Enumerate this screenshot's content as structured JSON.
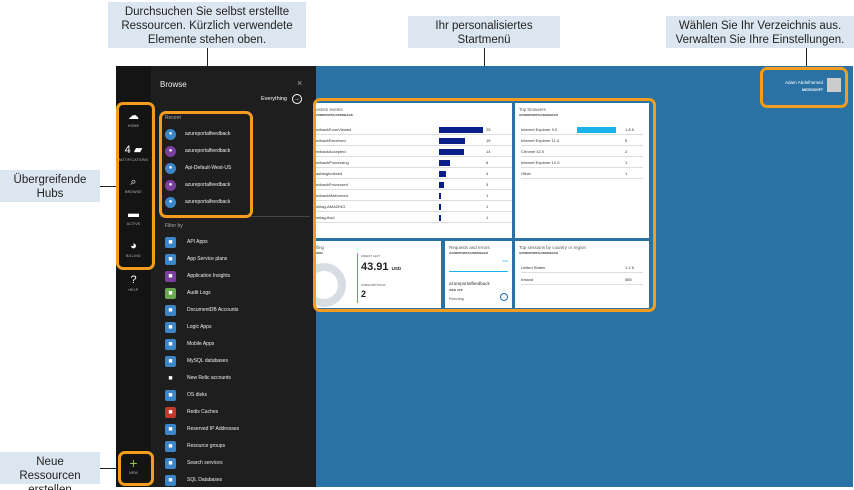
{
  "callouts": {
    "browse_resources": "Durchsuchen Sie selbst erstellte Ressourcen. Kürzlich verwendete Elemente stehen oben.",
    "personal_startboard": "Ihr personalisiertes Startmenü",
    "directory": "Wählen Sie Ihr Verzeichnis aus. Verwalten Sie Ihre Einstellungen.",
    "global_hubs": "Übergreifende Hubs",
    "new_resources": "Neue Ressourcen erstellen"
  },
  "hubs": [
    {
      "label": "HOME",
      "icon": "cloud-icon"
    },
    {
      "label": "NOTIFICATIONS",
      "count": "4",
      "icon": "notification-icon"
    },
    {
      "label": "BROWSE",
      "icon": "browse-icon"
    },
    {
      "label": "ACTIVE",
      "icon": "active-icon"
    },
    {
      "label": "BILLING",
      "icon": "billing-icon"
    },
    {
      "label": "HELP",
      "icon": "help-icon"
    },
    {
      "label": "NEW",
      "icon": "plus-icon"
    }
  ],
  "browse": {
    "title": "Browse",
    "close": "×",
    "everything": "Everything",
    "recent_label": "Recent",
    "recent": [
      {
        "label": "azureportalfeedback",
        "icon": "website-icon",
        "color": "#3a86c8"
      },
      {
        "label": "azureportalfeedback",
        "icon": "insights-icon",
        "color": "#7b3fa0"
      },
      {
        "label": "Api-Default-West-US",
        "icon": "resource-group-icon",
        "color": "#3a86c8"
      },
      {
        "label": "azureportalfeedback",
        "icon": "insights-icon",
        "color": "#7b3fa0"
      },
      {
        "label": "azureportalfeedback",
        "icon": "website-icon",
        "color": "#3a86c8"
      }
    ],
    "filter_label": "Filter by",
    "filter_items": [
      {
        "label": "API Apps",
        "icon": "api-apps-icon",
        "color": "#3a86c8"
      },
      {
        "label": "App Service plans",
        "icon": "app-service-plan-icon",
        "color": "#3a86c8"
      },
      {
        "label": "Application Insights",
        "icon": "insights-icon",
        "color": "#7b3fa0"
      },
      {
        "label": "Audit Logs",
        "icon": "audit-logs-icon",
        "color": "#6aa84f"
      },
      {
        "label": "DocumentDB Accounts",
        "icon": "documentdb-icon",
        "color": "#3a86c8"
      },
      {
        "label": "Logic Apps",
        "icon": "logic-apps-icon",
        "color": "#3a86c8"
      },
      {
        "label": "Mobile Apps",
        "icon": "mobile-apps-icon",
        "color": "#3a86c8"
      },
      {
        "label": "MySQL databases",
        "icon": "mysql-icon",
        "color": "#3a86c8"
      },
      {
        "label": "New Relic accounts",
        "icon": "new-relic-icon",
        "color": "#1e1e1e"
      },
      {
        "label": "OS disks",
        "icon": "disk-icon",
        "color": "#3a86c8"
      },
      {
        "label": "Redis Caches",
        "icon": "redis-icon",
        "color": "#c0392b"
      },
      {
        "label": "Reserved IP Addresses",
        "icon": "ip-address-icon",
        "color": "#3a86c8"
      },
      {
        "label": "Resource groups",
        "icon": "resource-group-icon",
        "color": "#3a86c8"
      },
      {
        "label": "Search services",
        "icon": "search-service-icon",
        "color": "#3a86c8"
      },
      {
        "label": "SQL Databases",
        "icon": "sql-database-icon",
        "color": "#3a86c8"
      }
    ]
  },
  "user": {
    "name": "Adam Abdelhamed",
    "directory": "MICROSOFT"
  },
  "tiles": {
    "custom_events": {
      "title": "ustom events",
      "subtitle": "ZUREPORTALFEEDBACK",
      "rows": [
        {
          "name": "edbackFormViewed",
          "value": 25
        },
        {
          "name": "edbackReceived",
          "value": 15
        },
        {
          "name": "edbackAccepted",
          "value": 14
        },
        {
          "name": "edbackProcessing",
          "value": 6
        },
        {
          "name": "ashtagIndexed",
          "value": 4
        },
        {
          "name": "edbackProcessed",
          "value": 3
        },
        {
          "name": "edbackMalformed",
          "value": 1
        },
        {
          "name": "shtag-AMAZING",
          "value": 1
        },
        {
          "name": "shtag-fluid",
          "value": 1
        }
      ]
    },
    "top_browsers": {
      "title": "Top browsers",
      "subtitle": "AZUREPORTALFEEDBACK",
      "rows": [
        {
          "name": "Internet Explorer 9.0",
          "value": "1.8 K",
          "fraction": 0.85
        },
        {
          "name": "Internet Explorer 11.0",
          "value": "5",
          "fraction": 0
        },
        {
          "name": "Chrome 42.0",
          "value": "2",
          "fraction": 0
        },
        {
          "name": "Internet Explorer 12.0",
          "value": "1",
          "fraction": 0
        },
        {
          "name": "Other",
          "value": "1",
          "fraction": 0
        }
      ]
    },
    "billing": {
      "title": "lling",
      "subtitle": "SON",
      "credit_label": "CREDIT LEFT",
      "credit_value": "43.91",
      "credit_unit": "USD",
      "subs_label": "SUBSCRIPTIONS",
      "subs_value": "2"
    },
    "requests": {
      "title": "Requests and errors",
      "subtitle": "AZUREPORTALFEEDBACK",
      "corner": "24H",
      "app_name": "azureportalfeedback",
      "app_type": "WEB APP",
      "status": "Running"
    },
    "top_sessions": {
      "title": "Top sessions by country or region",
      "subtitle": "AZUREPORTALFEEDBACK",
      "rows": [
        {
          "name": "United States",
          "value": "1.1 K"
        },
        {
          "name": "Ireland",
          "value": "585"
        }
      ]
    }
  },
  "colors": {
    "accent": "#f39c1f",
    "canvas": "#2a72a4",
    "bar_dark": "#0b1f8a",
    "bar_light": "#1bb1ea",
    "callout_bg": "#dce6f0"
  }
}
